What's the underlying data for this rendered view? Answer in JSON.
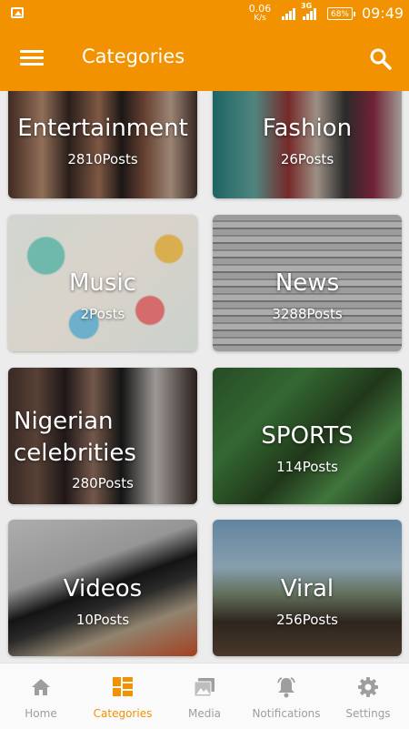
{
  "status": {
    "speed": "0.06",
    "speed_unit": "K/s",
    "network": "3G",
    "battery": "68%",
    "time": "09:49"
  },
  "appbar": {
    "title": "Categories"
  },
  "categories": [
    {
      "name": "Entertainment",
      "posts": "2810Posts"
    },
    {
      "name": "Fashion",
      "posts": "26Posts"
    },
    {
      "name": "Music",
      "posts": "2Posts"
    },
    {
      "name": "News",
      "posts": "3288Posts"
    },
    {
      "name": "Nigerian celebrities",
      "posts": "280Posts"
    },
    {
      "name": "SPORTS",
      "posts": "114Posts"
    },
    {
      "name": "Videos",
      "posts": "10Posts"
    },
    {
      "name": "Viral",
      "posts": "256Posts"
    }
  ],
  "nav": [
    {
      "label": "Home",
      "icon": "home-icon"
    },
    {
      "label": "Categories",
      "icon": "categories-icon"
    },
    {
      "label": "Media",
      "icon": "media-icon"
    },
    {
      "label": "Notifications",
      "icon": "notifications-icon"
    },
    {
      "label": "Settings",
      "icon": "settings-icon"
    }
  ],
  "colors": {
    "accent": "#f29200",
    "inactive": "#9e9e9e"
  }
}
